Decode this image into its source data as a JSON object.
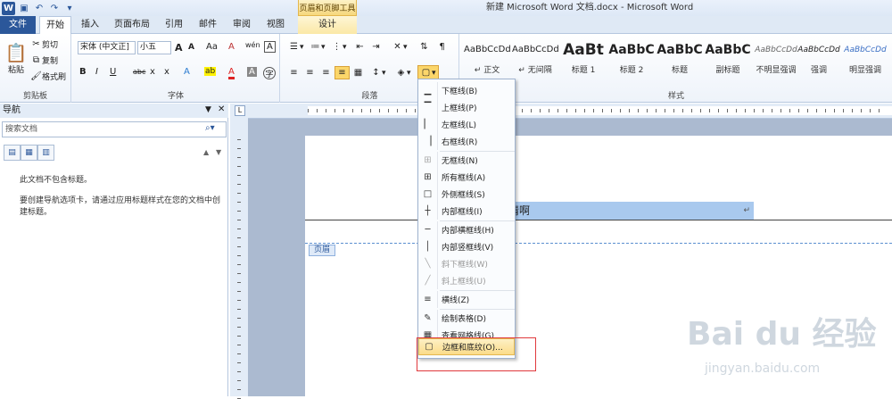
{
  "window": {
    "title": "新建 Microsoft Word 文档.docx - Microsoft Word",
    "context_tool": "页眉和页脚工具"
  },
  "tabs": [
    {
      "label": "文件"
    },
    {
      "label": "开始"
    },
    {
      "label": "插入"
    },
    {
      "label": "页面布局"
    },
    {
      "label": "引用"
    },
    {
      "label": "邮件"
    },
    {
      "label": "审阅"
    },
    {
      "label": "视图"
    },
    {
      "label": "设计"
    }
  ],
  "ribbon": {
    "clipboard": {
      "paste": "粘贴",
      "cut": "剪切",
      "copy": "复制",
      "format_painter": "格式刷",
      "label": "剪贴板"
    },
    "font": {
      "family": "宋体 (中文正]",
      "size": "小五",
      "label": "字体",
      "grow": "A",
      "shrink": "A",
      "case": "Aa",
      "clear": "A",
      "wen": "wén",
      "border_a": "A",
      "bold": "B",
      "italic": "I",
      "underline": "U",
      "strike": "abc",
      "sub": "x",
      "sup": "x",
      "fx": "A",
      "hl": "ab",
      "fcolor": "A",
      "shade": "A",
      "circle": "字"
    },
    "paragraph": {
      "label": "段落"
    },
    "styles": {
      "label": "样式",
      "items": [
        {
          "sample": "AaBbCcDd",
          "name": "↵ 正文"
        },
        {
          "sample": "AaBbCcDd",
          "name": "↵ 无间隔"
        },
        {
          "sample": "AaBt",
          "name": "标题 1"
        },
        {
          "sample": "AaBbC",
          "name": "标题 2"
        },
        {
          "sample": "AaBbC",
          "name": "标题"
        },
        {
          "sample": "AaBbC",
          "name": "副标题"
        },
        {
          "sample": "AaBbCcDd",
          "name": "不明显强调"
        },
        {
          "sample": "AaBbCcDd",
          "name": "强调"
        },
        {
          "sample": "AaBbCcDd",
          "name": "明显强调"
        }
      ]
    }
  },
  "nav": {
    "title": "导航",
    "search_placeholder": "搜索文档",
    "line1": "此文档不包含标题。",
    "line2": "要创建导航选项卡，请通过应用标题样式在您的文档中创建标题。"
  },
  "doc": {
    "header_text": "情啊",
    "header_mark": "↵",
    "header_tag": "页眉"
  },
  "menu": {
    "items": [
      {
        "label": "下框线(B)",
        "enabled": true
      },
      {
        "label": "上框线(P)",
        "enabled": true
      },
      {
        "label": "左框线(L)",
        "enabled": true
      },
      {
        "label": "右框线(R)",
        "enabled": true
      },
      {
        "label": "无框线(N)",
        "enabled": true
      },
      {
        "label": "所有框线(A)",
        "enabled": true
      },
      {
        "label": "外侧框线(S)",
        "enabled": true
      },
      {
        "label": "内部框线(I)",
        "enabled": true
      },
      {
        "label": "内部横框线(H)",
        "enabled": true
      },
      {
        "label": "内部竖框线(V)",
        "enabled": true
      },
      {
        "label": "斜下框线(W)",
        "enabled": false
      },
      {
        "label": "斜上框线(U)",
        "enabled": false
      },
      {
        "label": "横线(Z)",
        "enabled": true
      },
      {
        "label": "绘制表格(D)",
        "enabled": true
      },
      {
        "label": "查看网格线(G)",
        "enabled": true
      },
      {
        "label": "边框和底纹(O)...",
        "enabled": true,
        "highlighted": true
      }
    ]
  },
  "watermark": {
    "logo": "Bai du 经验",
    "url": "jingyan.baidu.com"
  }
}
